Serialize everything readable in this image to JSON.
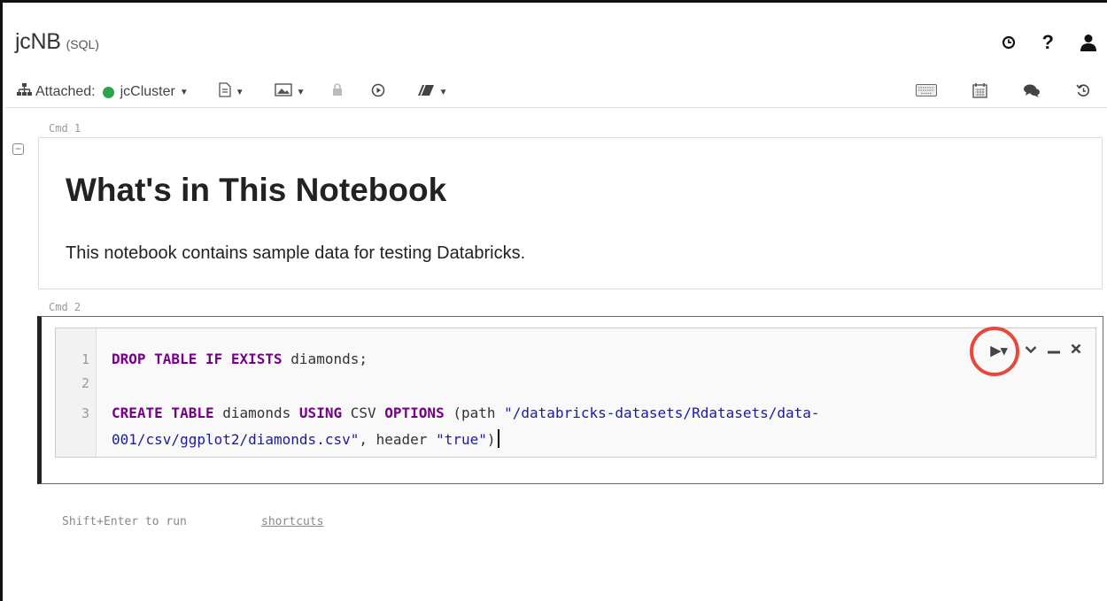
{
  "header": {
    "title": "jcNB",
    "language": "(SQL)",
    "icons": [
      "clock-icon",
      "help-icon",
      "user-icon"
    ]
  },
  "toolbar": {
    "attached_label": "Attached:",
    "cluster_name": "jcCluster",
    "cluster_status_color": "#2ba44e",
    "tools": [
      "file-icon",
      "image-icon",
      "lock-icon",
      "run-all-icon",
      "clear-icon"
    ],
    "right_tools": [
      "keyboard-icon",
      "schedule-icon",
      "comments-icon",
      "revision-history-icon"
    ]
  },
  "cells": [
    {
      "cmd_label": "Cmd 1",
      "heading": "What's in This Notebook",
      "text": "This notebook contains sample data for testing Databricks."
    },
    {
      "cmd_label": "Cmd 2",
      "line_numbers": [
        "1",
        "2",
        "3"
      ],
      "code": {
        "l1_kw": "DROP TABLE IF EXISTS",
        "l1_rest": " diamonds;",
        "l3_kw1": "CREATE TABLE",
        "l3_t1": " diamonds ",
        "l3_kw2": "USING",
        "l3_t2": " CSV ",
        "l3_kw3": "OPTIONS",
        "l3_t3": " (path ",
        "l3_str1": "\"/databricks-datasets/Rdatasets/data-",
        "l4_str1": "001/csv/ggplot2/diamonds.csv\"",
        "l4_t1": ", header ",
        "l4_str2": "\"true\"",
        "l4_t2": ")"
      },
      "actions": [
        "run-icon",
        "expand-icon",
        "minimize-icon",
        "delete-icon"
      ]
    }
  ],
  "footer": {
    "hint": "Shift+Enter to run",
    "shortcuts_link": "shortcuts"
  }
}
